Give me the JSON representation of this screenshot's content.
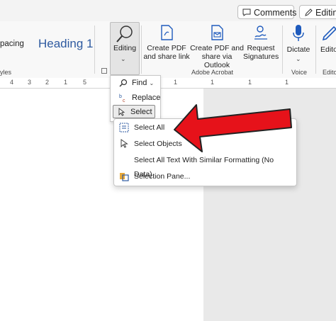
{
  "topbar": {
    "comments_label": "Comments",
    "editing_label": "Editing"
  },
  "ribbon": {
    "styles": {
      "spacing_style": "pacing",
      "heading1_style": "Heading 1",
      "group_label": "yles"
    },
    "editing": {
      "label": "Editing",
      "chevron": "⌄"
    },
    "acrobat": {
      "create_pdf": [
        "Create PDF",
        "and share link"
      ],
      "create_pdf_outlook": [
        "Create PDF and",
        "share via Outlook"
      ],
      "request_signatures": [
        "Request",
        "Signatures"
      ],
      "group_label": "Adobe Acrobat"
    },
    "voice": {
      "dictate": "Dictate",
      "chevron": "⌄",
      "group_label": "Voice"
    },
    "editor": {
      "label": "Edito",
      "group_label": "Edito"
    }
  },
  "ruler": {
    "numbers": [
      "4",
      "3",
      "2",
      "1",
      "5",
      "1",
      "1",
      "1",
      "1"
    ]
  },
  "editing_dropdown": {
    "find": "Find",
    "replace": "Replace",
    "select": "Select",
    "chevron": "⌄"
  },
  "select_menu": {
    "select_all": "Select All",
    "select_objects": "Select Objects",
    "select_similar": "Select All Text With Similar Formatting (No Data)",
    "selection_pane": "Selection Pane..."
  },
  "colors": {
    "arrow": "#e6121a",
    "accent": "#2e5aa0",
    "acrobat_icon": "#1f5bbd"
  }
}
